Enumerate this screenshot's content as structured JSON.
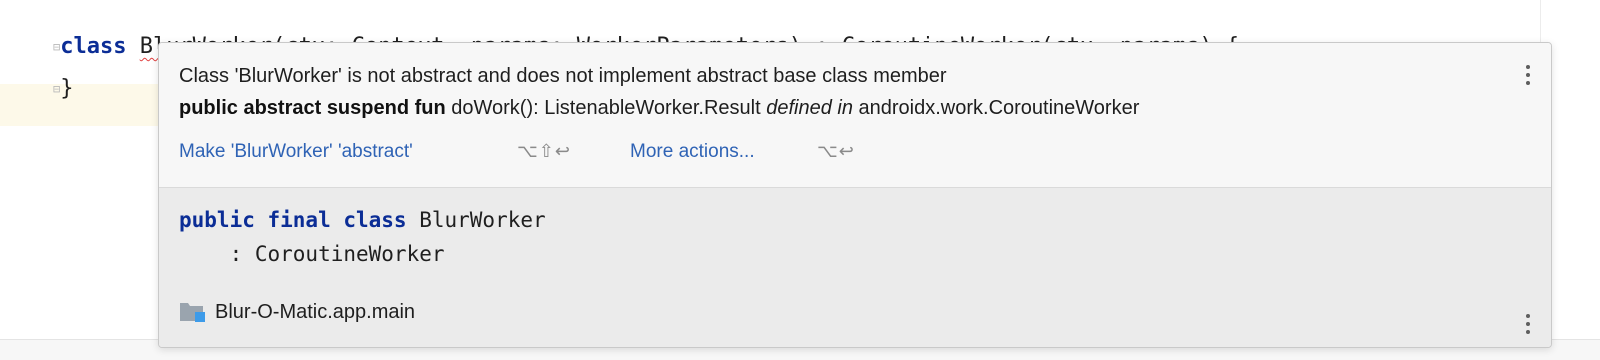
{
  "editor": {
    "line1": {
      "keyword": "class",
      "class_name": "BlurWorker",
      "rest": "(ctx: Context, params: WorkerParameters) : CoroutineWorker(ctx, params) {"
    },
    "line2": "}"
  },
  "popup": {
    "message_line1": "Class 'BlurWorker' is not abstract and does not implement abstract base class member",
    "message_line2": {
      "signature_bold": "public abstract suspend fun",
      "signature_rest": " doWork(): ListenableWorker.Result ",
      "defined_in": "defined in",
      "location": " androidx.work.CoroutineWorker"
    },
    "actions": [
      {
        "label": "Make 'BlurWorker' 'abstract'",
        "shortcut": "⌥⇧↩"
      },
      {
        "label": "More actions...",
        "shortcut": "⌥↩"
      }
    ],
    "doc": {
      "keywords": "public final class",
      "class_name": " BlurWorker",
      "supertype": "    : CoroutineWorker",
      "module": "Blur-O-Matic.app.main"
    }
  },
  "icons": {
    "kebab_top": "more-vertical-icon",
    "kebab_bottom": "more-vertical-icon",
    "module": "module-folder-icon"
  },
  "colors": {
    "keyword": "#0b2d96",
    "link": "#2f63b5",
    "error_underline": "#e04040"
  }
}
